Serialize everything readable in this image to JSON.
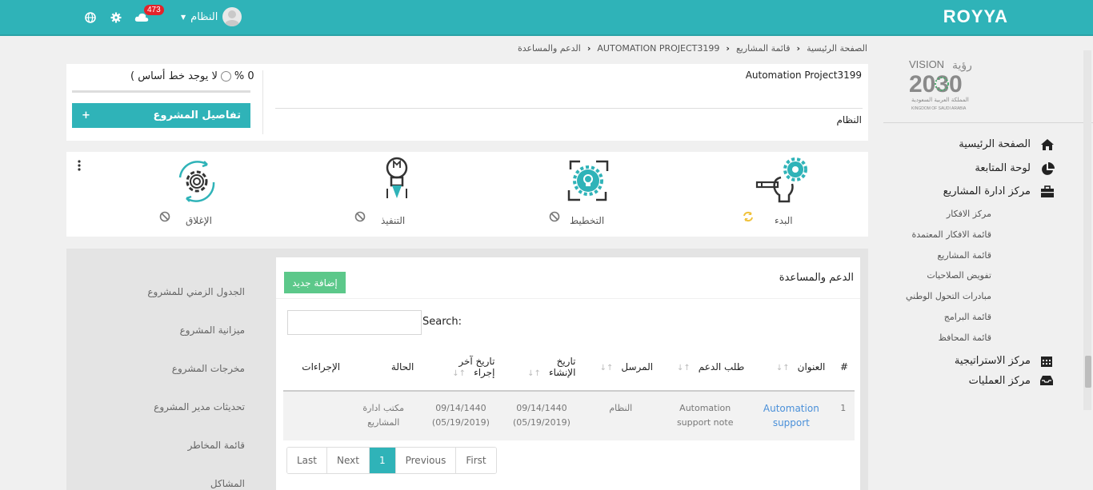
{
  "brand": "ROYYA",
  "topbar": {
    "notifications_count": "473",
    "user_name": "النظام",
    "icons": [
      "globe-icon",
      "gear-icon",
      "cloud-icon"
    ]
  },
  "breadcrumb": [
    "الصفحة الرئيسية",
    "قائمة المشاريع",
    "AUTOMATION PROJECT3199",
    "الدعم والمساعدة"
  ],
  "project": {
    "name": "Automation Project3199",
    "owner": "النظام",
    "baseline_percent": "0 %",
    "baseline_text": "لا يوجد خط أساس )",
    "details_button": "تفاصيل المشروع",
    "details_plus": "+"
  },
  "phases": [
    {
      "label": "البدء",
      "icon": "gear-lightbulb-icon",
      "status_icon": "refresh-icon"
    },
    {
      "label": "التخطيط",
      "icon": "cycle-gear-icon",
      "status_icon": "disabled-icon"
    },
    {
      "label": "التنفيذ",
      "icon": "rocket-bulb-icon",
      "status_icon": "disabled-icon"
    },
    {
      "label": "الإغلاق",
      "icon": "gear-cycle-icon",
      "status_icon": "disabled-icon"
    }
  ],
  "sidebar": {
    "logo_text": "VISION 2030",
    "logo_ar": "رؤية",
    "logo_sub_ar": "المملكة العربية السعودية",
    "logo_sub_en": "KINGDOM OF SAUDI ARABIA",
    "main_items": [
      {
        "label": "الصفحة الرئيسية",
        "icon": "home-icon"
      },
      {
        "label": "لوحة المتابعة",
        "icon": "pie-chart-icon"
      },
      {
        "label": "مركز ادارة المشاريع",
        "icon": "briefcase-icon"
      }
    ],
    "sub_items": [
      "مركز الافكار",
      "قائمة الافكار المعتمدة",
      "قائمة المشاريع",
      "تفويض الصلاحيات",
      "مبادرات التحول الوطني",
      "قائمة البرامج",
      "قائمة المحافظ"
    ],
    "bottom_items": [
      {
        "label": "مركز الاستراتيجية",
        "icon": "calendar-icon"
      },
      {
        "label": "مركز العمليات",
        "icon": "inbox-icon"
      }
    ]
  },
  "project_menu": [
    "الجدول الزمني للمشروع",
    "ميزانية المشروع",
    "مخرجات المشروع",
    "تحديثات مدير المشروع",
    "قائمة المخاطر",
    "المشاكل"
  ],
  "support": {
    "title": "الدعم والمساعدة",
    "add_button": "إضافة جديد",
    "search_label": "Search:",
    "search_value": "",
    "columns": [
      "#",
      "العنوان",
      "طلب الدعم",
      "المرسل",
      "تاريخ الإنشاء",
      "تاريخ آخر إجراء",
      "الحالة",
      "الإجراءات"
    ],
    "rows": [
      {
        "num": "1",
        "title": "Automation support",
        "request": "Automation support note",
        "sender": "النظام",
        "created": "09/14/1440 (05/19/2019)",
        "last_action": "09/14/1440 (05/19/2019)",
        "status": "مكتب ادارة المشاريع",
        "actions": ""
      }
    ],
    "pager": [
      "Last",
      "Next",
      "1",
      "Previous",
      "First"
    ]
  },
  "colors": {
    "primary": "#2fb3b8",
    "add_button": "#5cc88a",
    "badge": "#e4232a",
    "link": "#4a90d9"
  }
}
